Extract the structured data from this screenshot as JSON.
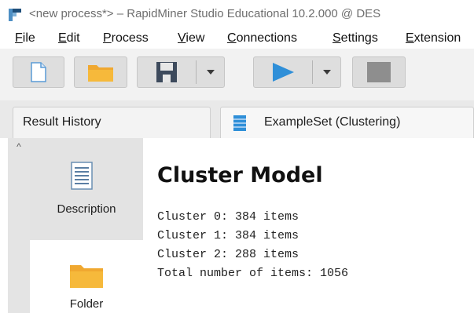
{
  "window": {
    "title": "<new process*> – RapidMiner Studio Educational 10.2.000 @ DES"
  },
  "menu": {
    "items": [
      {
        "label": "File",
        "mnemonic": "F",
        "rest": "ile"
      },
      {
        "label": "Edit",
        "mnemonic": "E",
        "rest": "dit"
      },
      {
        "label": "Process",
        "mnemonic": "P",
        "rest": "rocess"
      },
      {
        "label": "View",
        "mnemonic": "V",
        "rest": "iew"
      },
      {
        "label": "Connections",
        "mnemonic": "C",
        "rest": "onnections"
      },
      {
        "label": "Settings",
        "mnemonic": "S",
        "rest": "ettings"
      },
      {
        "label": "Extension",
        "mnemonic": "E",
        "rest": "xtension"
      }
    ]
  },
  "toolbar": {
    "buttons": [
      {
        "name": "new-process",
        "icon": "new-document-icon"
      },
      {
        "name": "open-process",
        "icon": "folder-icon"
      },
      {
        "name": "save-process",
        "icon": "save-icon"
      },
      {
        "name": "save-dropdown",
        "icon": "chevron-down-icon"
      },
      {
        "name": "run-process",
        "icon": "play-icon"
      },
      {
        "name": "run-dropdown",
        "icon": "chevron-down-icon"
      },
      {
        "name": "stop-process",
        "icon": "stop-icon"
      }
    ],
    "colors": {
      "play": "#2f8fd8",
      "folder": "#f6b93b",
      "save": "#3d4a5c",
      "stop": "#8e8e8e"
    }
  },
  "tabs": {
    "result_history": "Result History",
    "exampleset": "ExampleSet (Clustering)"
  },
  "sidebar": {
    "items": [
      {
        "label": "Description",
        "icon": "description-icon",
        "selected": true
      },
      {
        "label": "Folder",
        "icon": "folder-icon",
        "selected": false
      }
    ]
  },
  "cluster_model": {
    "title": "Cluster Model",
    "lines": [
      "Cluster 0: 384 items",
      "Cluster 1: 384 items",
      "Cluster 2: 288 items",
      "Total number of items: 1056"
    ]
  }
}
